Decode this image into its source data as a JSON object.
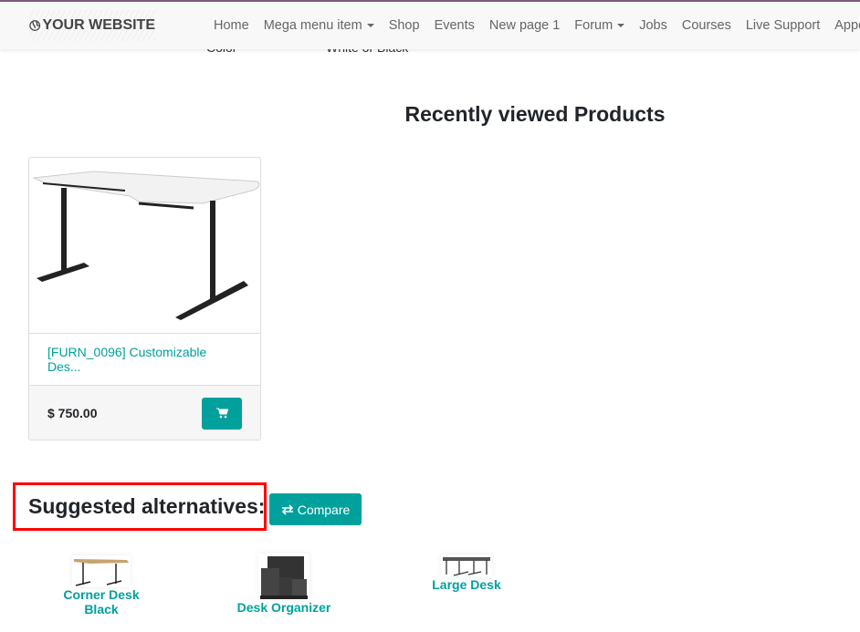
{
  "brand": {
    "name": "YOUR WEBSITE",
    "accent": "#00a09d",
    "topbar": "#7c5a78"
  },
  "behind": {
    "label": "Color",
    "value": "White or Black"
  },
  "nav": {
    "items": [
      {
        "label": "Home"
      },
      {
        "label": "Mega menu item",
        "dropdown": true
      },
      {
        "label": "Shop"
      },
      {
        "label": "Events"
      },
      {
        "label": "New page 1"
      },
      {
        "label": "Forum",
        "dropdown": true
      },
      {
        "label": "Jobs"
      },
      {
        "label": "Courses"
      },
      {
        "label": "Live Support"
      },
      {
        "label": "Appoin"
      }
    ]
  },
  "recent": {
    "title": "Recently viewed Products",
    "product": {
      "name": "[FURN_0096] Customizable Des...",
      "price": "$ 750.00",
      "cart_icon": "shopping-cart-icon"
    }
  },
  "suggested": {
    "title": "Suggested alternatives:",
    "compare_label": "Compare",
    "compare_icon": "exchange-icon",
    "items": [
      {
        "name": "Corner Desk Black"
      },
      {
        "name": "Desk Organizer"
      },
      {
        "name": "Large Desk"
      }
    ]
  }
}
